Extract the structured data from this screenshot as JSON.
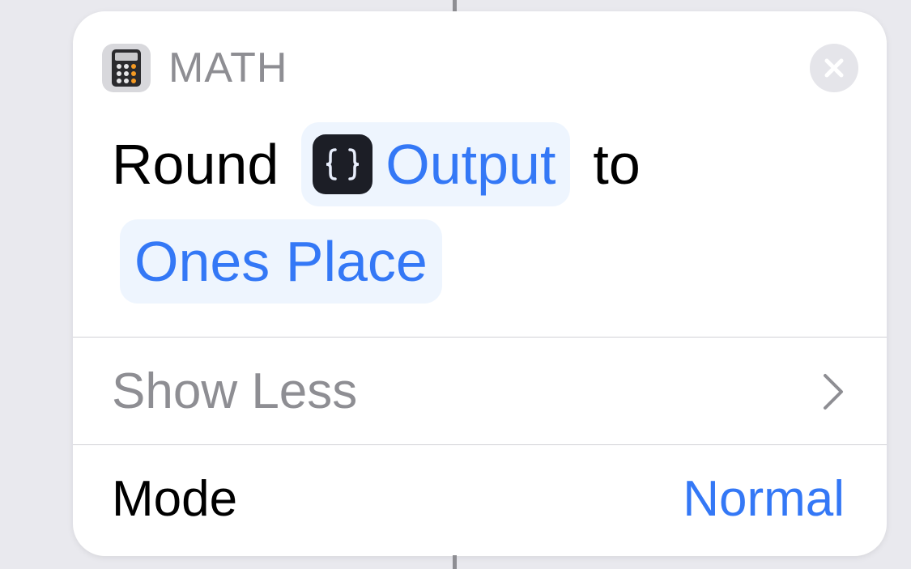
{
  "action": {
    "category": "MATH",
    "app_icon": "calculator-icon",
    "close_icon": "close-icon"
  },
  "sentence": {
    "verb": "Round",
    "variable": {
      "icon": "curly-braces-icon",
      "label": "Output"
    },
    "connector": "to",
    "precision": "Ones Place"
  },
  "options": {
    "toggle_label": "Show Less",
    "mode_label": "Mode",
    "mode_value": "Normal"
  },
  "colors": {
    "accent": "#3478f6",
    "token_background": "#eef5fe",
    "muted_text": "#8e8e93",
    "card_background": "#ffffff",
    "page_background": "#e9e9ee"
  }
}
